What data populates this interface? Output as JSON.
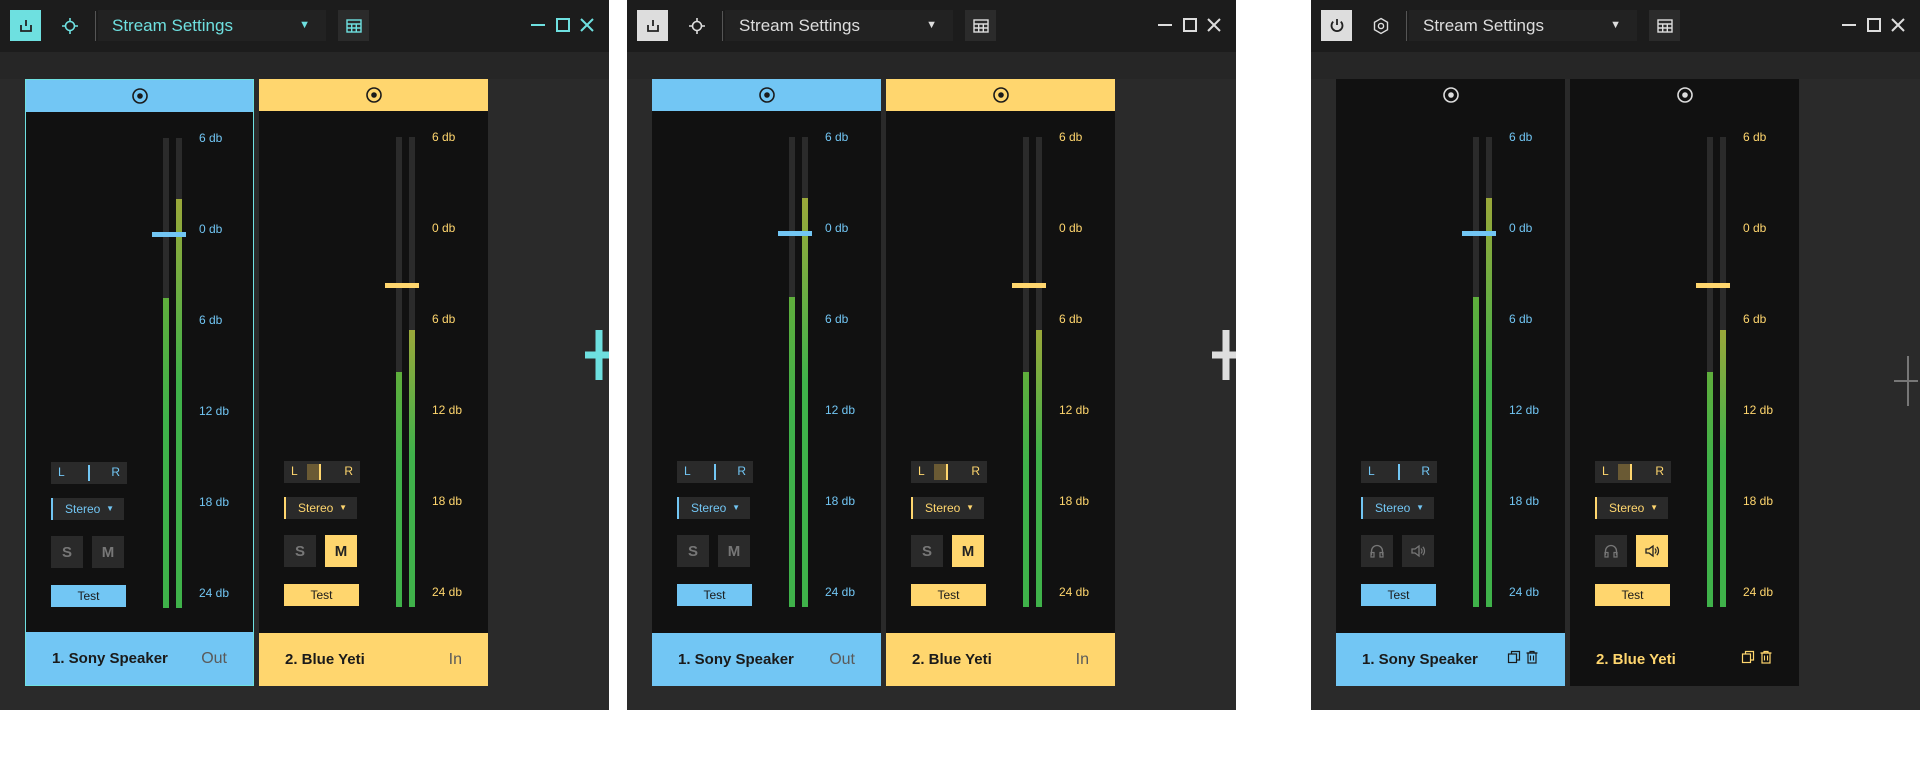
{
  "windows": [
    {
      "title": "Stream Settings",
      "theme": "teal",
      "channels": [
        {
          "name": "1. Sony Speaker",
          "direction": "Out",
          "fader_level": 0.8,
          "meter_left": 0.66,
          "meter_right": 0.87,
          "pan_left": "L",
          "pan_right": "R",
          "pan_position": 0.5,
          "mode": "Stereo",
          "solo_label": "S",
          "mute_label": "M",
          "mute_active": false,
          "test_label": "Test"
        },
        {
          "name": "2. Blue Yeti",
          "direction": "In",
          "fader_level": 0.69,
          "meter_left": 0.5,
          "meter_right": 0.59,
          "pan_left": "L",
          "pan_right": "R",
          "pan_position": 0.38,
          "mode": "Stereo",
          "solo_label": "S",
          "mute_label": "M",
          "mute_active": true,
          "test_label": "Test"
        }
      ]
    },
    {
      "title": "Stream Settings",
      "theme": "light",
      "channels": [
        {
          "name": "1. Sony Speaker",
          "direction": "Out",
          "fader_level": 0.8,
          "meter_left": 0.66,
          "meter_right": 0.87,
          "pan_left": "L",
          "pan_right": "R",
          "pan_position": 0.5,
          "mode": "Stereo",
          "solo_label": "S",
          "mute_label": "M",
          "mute_active": false,
          "test_label": "Test"
        },
        {
          "name": "2. Blue Yeti",
          "direction": "In",
          "fader_level": 0.69,
          "meter_left": 0.5,
          "meter_right": 0.59,
          "pan_left": "L",
          "pan_right": "R",
          "pan_position": 0.38,
          "mode": "Stereo",
          "solo_label": "S",
          "mute_label": "M",
          "mute_active": true,
          "test_label": "Test"
        }
      ]
    },
    {
      "title": "Stream Settings",
      "theme": "dark",
      "channels": [
        {
          "name": "1. Sony Speaker",
          "fader_level": 0.8,
          "meter_left": 0.66,
          "meter_right": 0.87,
          "pan_left": "L",
          "pan_right": "R",
          "pan_position": 0.5,
          "mode": "Stereo",
          "solo_icon": "headphones-icon",
          "mute_icon": "speaker-icon",
          "mute_active": false,
          "test_label": "Test",
          "selected": true
        },
        {
          "name": "2. Blue Yeti",
          "fader_level": 0.69,
          "meter_left": 0.5,
          "meter_right": 0.59,
          "pan_left": "L",
          "pan_right": "R",
          "pan_position": 0.38,
          "mode": "Stereo",
          "solo_icon": "headphones-icon",
          "mute_icon": "speaker-icon",
          "mute_active": true,
          "test_label": "Test",
          "selected": false
        }
      ]
    }
  ],
  "db_scale": [
    "6 db",
    "0 db",
    "6 db",
    "12 db",
    "18 db",
    "24 db"
  ],
  "colors": {
    "teal": "#6ee0e0",
    "blue": "#72c6f4",
    "yellow": "#ffd66e",
    "meter_green": "#3fb24a",
    "meter_olive": "#9aa83a",
    "light_gray": "#dddddd",
    "dark_foot": "#111111"
  }
}
